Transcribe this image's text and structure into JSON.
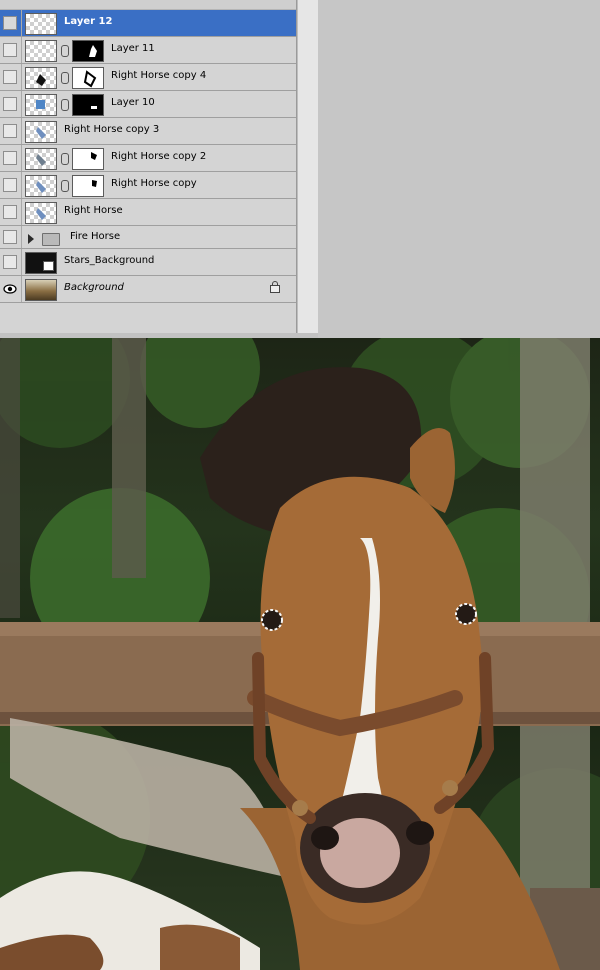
{
  "layers_panel": {
    "layers": [
      {
        "name": "Layer 12",
        "selected": true,
        "visible": false,
        "has_mask": false,
        "has_link": false,
        "italic": false
      },
      {
        "name": "Layer 11",
        "selected": false,
        "visible": false,
        "has_mask": true,
        "mask": "black",
        "has_link": true,
        "italic": false
      },
      {
        "name": "Right Horse copy 4",
        "selected": false,
        "visible": false,
        "has_mask": true,
        "mask": "white",
        "has_link": true,
        "italic": false
      },
      {
        "name": "Layer 10",
        "selected": false,
        "visible": false,
        "has_mask": true,
        "mask": "black",
        "has_link": true,
        "italic": false
      },
      {
        "name": "Right Horse copy 3",
        "selected": false,
        "visible": false,
        "has_mask": false,
        "has_link": false,
        "italic": false
      },
      {
        "name": "Right Horse copy 2",
        "selected": false,
        "visible": false,
        "has_mask": true,
        "mask": "white",
        "has_link": true,
        "italic": false
      },
      {
        "name": "Right Horse copy",
        "selected": false,
        "visible": false,
        "has_mask": true,
        "mask": "white",
        "has_link": true,
        "italic": false
      },
      {
        "name": "Right Horse",
        "selected": false,
        "visible": false,
        "has_mask": false,
        "has_link": false,
        "italic": false
      },
      {
        "name": "Fire Horse",
        "selected": false,
        "visible": false,
        "is_group": true,
        "italic": false
      },
      {
        "name": "Stars_Background",
        "selected": false,
        "visible": false,
        "has_mask": false,
        "has_link": false,
        "italic": false
      },
      {
        "name": "Background",
        "selected": false,
        "visible": true,
        "has_mask": false,
        "has_link": false,
        "italic": true,
        "locked": true
      }
    ]
  },
  "photo": {
    "subject": "horse-photo"
  },
  "colors": {
    "selection": "#3a6fc5",
    "panel": "#d4d4d4"
  }
}
